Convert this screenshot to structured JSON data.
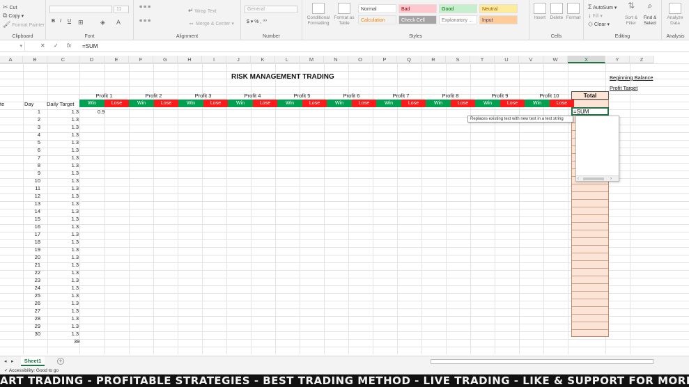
{
  "ribbon": {
    "clipboard": {
      "cut": "Cut",
      "copy": "Copy",
      "format_painter": "Format Painter",
      "label": "Clipboard"
    },
    "font": {
      "label": "Font",
      "size": "11"
    },
    "alignment": {
      "wrap_text": "Wrap Text",
      "merge_center": "Merge & Center",
      "label": "Alignment"
    },
    "number": {
      "format": "General",
      "label": "Number"
    },
    "styles": {
      "conditional": "Conditional Formatting",
      "format_as_table": "Format as Table",
      "cells": [
        {
          "label": "Normal",
          "bg": "#ffffff",
          "fg": "#444444"
        },
        {
          "label": "Bad",
          "bg": "#ffc7ce",
          "fg": "#9c0006"
        },
        {
          "label": "Good",
          "bg": "#c6efce",
          "fg": "#006100"
        },
        {
          "label": "Neutral",
          "bg": "#ffeb9c",
          "fg": "#9c5700"
        },
        {
          "label": "Calculation",
          "bg": "#f2f2f2",
          "fg": "#fa7d00"
        },
        {
          "label": "Check Cell",
          "bg": "#a5a5a5",
          "fg": "#ffffff"
        },
        {
          "label": "Explanatory ...",
          "bg": "#ffffff",
          "fg": "#7f7f7f"
        },
        {
          "label": "Input",
          "bg": "#ffcc99",
          "fg": "#3f3f76"
        }
      ],
      "label": "Styles"
    },
    "cells": {
      "insert": "Insert",
      "delete": "Delete",
      "format": "Format",
      "label": "Cells"
    },
    "editing": {
      "autosum": "AutoSum",
      "fill": "Fill",
      "clear": "Clear",
      "sort_filter": "Sort & Filter",
      "find_select": "Find & Select",
      "label": "Editing"
    },
    "analysis": {
      "analyze": "Analyze Data",
      "label": "Analysis"
    }
  },
  "formula_bar": {
    "cancel": "✕",
    "enter": "✓",
    "fx": "fx",
    "content": "=SUM"
  },
  "columns": [
    "A",
    "B",
    "C",
    "D",
    "E",
    "F",
    "G",
    "H",
    "I",
    "J",
    "K",
    "L",
    "M",
    "N",
    "O",
    "P",
    "Q",
    "R",
    "S",
    "T",
    "U",
    "V",
    "W",
    "X",
    "Y",
    "Z"
  ],
  "sheet": {
    "title": "RISK MANAGEMENT TRADING",
    "headers": {
      "date": "te",
      "day": "Day",
      "daily_target": "Daily Target",
      "total": "Total"
    },
    "profits": [
      "Profit 1",
      "Profit 2",
      "Profit 3",
      "Profit 4",
      "Profit 5",
      "Profit 6",
      "Profit 7",
      "Profit 8",
      "Profit 9",
      "Profit 10"
    ],
    "win_label": "Win",
    "lose_label": "Lose",
    "days": [
      1,
      2,
      3,
      4,
      5,
      6,
      7,
      8,
      9,
      10,
      11,
      12,
      13,
      14,
      15,
      16,
      17,
      18,
      19,
      20,
      21,
      22,
      23,
      24,
      25,
      26,
      27,
      28,
      29,
      30
    ],
    "target": "1.3",
    "first_win": "0.9",
    "day_total": "39",
    "beginning_balance": "Beginning Balance",
    "profit_target": "Profit Target",
    "active_cell": "=SUM",
    "tooltip": "Replaces existing text with new text in a text string"
  },
  "sheet_tab": "Sheet1",
  "status": "Accessibility: Good to go",
  "banner": "ART TRADING - PROFITABLE STRATEGIES - BEST TRADING METHOD - LIVE TRADING - LIKE & SUPPORT FOR MORE FREE STRATEG"
}
